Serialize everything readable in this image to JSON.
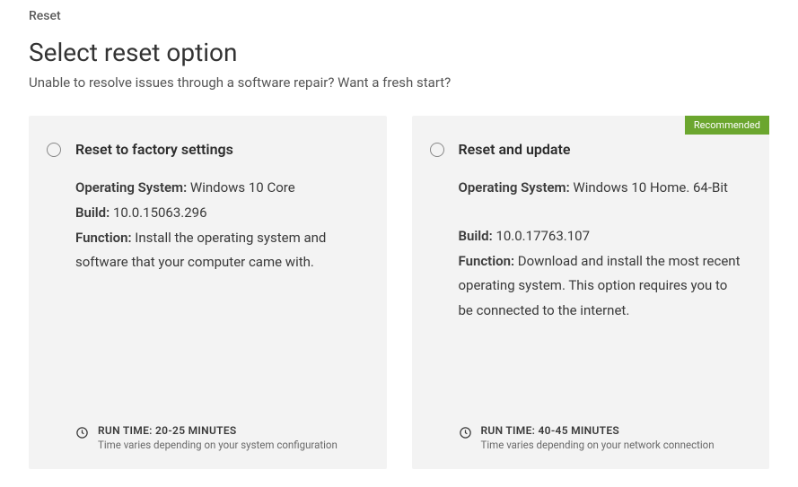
{
  "breadcrumb": "Reset",
  "title": "Select reset option",
  "subtitle": "Unable to resolve issues through a software repair? Want a fresh start?",
  "labels": {
    "os": "Operating System:",
    "build": "Build:",
    "function": "Function:"
  },
  "cards": [
    {
      "title": "Reset to factory settings",
      "os": " Windows 10 Core",
      "build": " 10.0.15063.296",
      "function": " Install the operating system and software that your computer came with.",
      "runtime": "RUN TIME: 20-25 MINUTES",
      "varies": "Time varies depending on your system configuration",
      "badge": null
    },
    {
      "title": "Reset and update",
      "os": " Windows 10 Home. 64-Bit",
      "build": " 10.0.17763.107",
      "function": " Download and install the most recent operating system. This option requires you to be connected to the internet.",
      "runtime": "RUN TIME: 40-45 MINUTES",
      "varies": "Time varies depending on your network connection",
      "badge": "Recommended"
    }
  ]
}
